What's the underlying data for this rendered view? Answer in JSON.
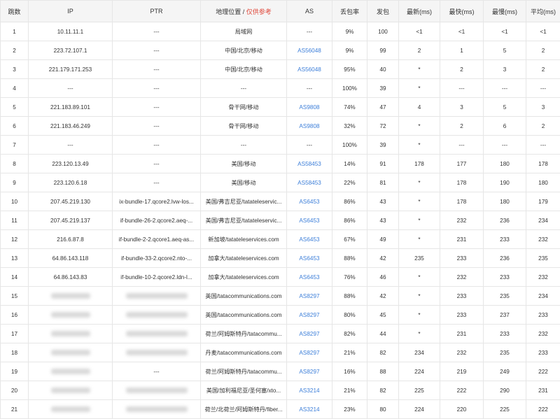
{
  "columns": {
    "hop": "跳数",
    "ip": "IP",
    "ptr": "PTR",
    "geo": "地理位置",
    "geo_sep": "/",
    "geo_note": "仅供参考",
    "as": "AS",
    "loss": "丢包率",
    "sent": "发包",
    "latest": "最新(ms)",
    "fastest": "最快(ms)",
    "slowest": "最慢(ms)",
    "avg": "平均(ms)"
  },
  "rows": [
    {
      "hop": "1",
      "ip": "10.11.11.1",
      "ptr": "---",
      "geo": "局域网",
      "as": "---",
      "loss": "9%",
      "sent": "100",
      "latest": "<1",
      "fastest": "<1",
      "slowest": "<1",
      "avg": "<1"
    },
    {
      "hop": "2",
      "ip": "223.72.107.1",
      "ptr": "---",
      "geo": "中国/北京/移动",
      "as": "AS56048",
      "loss": "9%",
      "sent": "99",
      "latest": "2",
      "fastest": "1",
      "slowest": "5",
      "avg": "2"
    },
    {
      "hop": "3",
      "ip": "221.179.171.253",
      "ptr": "---",
      "geo": "中国/北京/移动",
      "as": "AS56048",
      "loss": "95%",
      "sent": "40",
      "latest": "*",
      "fastest": "2",
      "slowest": "3",
      "avg": "2"
    },
    {
      "hop": "4",
      "ip": "---",
      "ptr": "---",
      "geo": "---",
      "as": "---",
      "loss": "100%",
      "sent": "39",
      "latest": "*",
      "fastest": "---",
      "slowest": "---",
      "avg": "---"
    },
    {
      "hop": "5",
      "ip": "221.183.89.101",
      "ptr": "---",
      "geo": "骨干网/移动",
      "as": "AS9808",
      "loss": "74%",
      "sent": "47",
      "latest": "4",
      "fastest": "3",
      "slowest": "5",
      "avg": "3"
    },
    {
      "hop": "6",
      "ip": "221.183.46.249",
      "ptr": "---",
      "geo": "骨干网/移动",
      "as": "AS9808",
      "loss": "32%",
      "sent": "72",
      "latest": "*",
      "fastest": "2",
      "slowest": "6",
      "avg": "2"
    },
    {
      "hop": "7",
      "ip": "---",
      "ptr": "---",
      "geo": "---",
      "as": "---",
      "loss": "100%",
      "sent": "39",
      "latest": "*",
      "fastest": "---",
      "slowest": "---",
      "avg": "---"
    },
    {
      "hop": "8",
      "ip": "223.120.13.49",
      "ptr": "---",
      "geo": "美国/移动",
      "as": "AS58453",
      "loss": "14%",
      "sent": "91",
      "latest": "178",
      "fastest": "177",
      "slowest": "180",
      "avg": "178"
    },
    {
      "hop": "9",
      "ip": "223.120.6.18",
      "ptr": "---",
      "geo": "美国/移动",
      "as": "AS58453",
      "loss": "22%",
      "sent": "81",
      "latest": "*",
      "fastest": "178",
      "slowest": "190",
      "avg": "180"
    },
    {
      "hop": "10",
      "ip": "207.45.219.130",
      "ptr": "ix-bundle-17.qcore2.lvw-los...",
      "geo": "美国/弗吉尼亚/tatateleservic...",
      "as": "AS6453",
      "loss": "86%",
      "sent": "43",
      "latest": "*",
      "fastest": "178",
      "slowest": "180",
      "avg": "179"
    },
    {
      "hop": "11",
      "ip": "207.45.219.137",
      "ptr": "if-bundle-26-2.qcore2.aeq-...",
      "geo": "美国/弗吉尼亚/tatateleservic...",
      "as": "AS6453",
      "loss": "86%",
      "sent": "43",
      "latest": "*",
      "fastest": "232",
      "slowest": "236",
      "avg": "234"
    },
    {
      "hop": "12",
      "ip": "216.6.87.8",
      "ptr": "if-bundle-2-2.qcore1.aeq-as...",
      "geo": "新加坡/tatateleservices.com",
      "as": "AS6453",
      "loss": "67%",
      "sent": "49",
      "latest": "*",
      "fastest": "231",
      "slowest": "233",
      "avg": "232"
    },
    {
      "hop": "13",
      "ip": "64.86.143.118",
      "ptr": "if-bundle-33-2.qcore2.nto-...",
      "geo": "加拿大/tatateleservices.com",
      "as": "AS6453",
      "loss": "88%",
      "sent": "42",
      "latest": "235",
      "fastest": "233",
      "slowest": "236",
      "avg": "235"
    },
    {
      "hop": "14",
      "ip": "64.86.143.83",
      "ptr": "if-bundle-10-2.qcore2.ldn-l...",
      "geo": "加拿大/tatateleservices.com",
      "as": "AS6453",
      "loss": "76%",
      "sent": "46",
      "latest": "*",
      "fastest": "232",
      "slowest": "233",
      "avg": "232"
    },
    {
      "hop": "15",
      "ip": "",
      "ptr": "",
      "geo": "英国/tatacommunications.com",
      "as": "AS8297",
      "loss": "88%",
      "sent": "42",
      "latest": "*",
      "fastest": "233",
      "slowest": "235",
      "avg": "234"
    },
    {
      "hop": "16",
      "ip": "",
      "ptr": "",
      "geo": "英国/tatacommunications.com",
      "as": "AS8297",
      "loss": "80%",
      "sent": "45",
      "latest": "*",
      "fastest": "233",
      "slowest": "237",
      "avg": "233"
    },
    {
      "hop": "17",
      "ip": "",
      "ptr": "",
      "geo": "荷兰/阿姆斯特丹/tatacommu...",
      "as": "AS8297",
      "loss": "82%",
      "sent": "44",
      "latest": "*",
      "fastest": "231",
      "slowest": "233",
      "avg": "232"
    },
    {
      "hop": "18",
      "ip": "",
      "ptr": "",
      "geo": "丹麦/tatacommunications.com",
      "as": "AS8297",
      "loss": "21%",
      "sent": "82",
      "latest": "234",
      "fastest": "232",
      "slowest": "235",
      "avg": "233"
    },
    {
      "hop": "19",
      "ip": "",
      "ptr": "---",
      "geo": "荷兰/阿姆斯特丹/tatacommu...",
      "as": "AS8297",
      "loss": "16%",
      "sent": "88",
      "latest": "224",
      "fastest": "219",
      "slowest": "249",
      "avg": "222"
    },
    {
      "hop": "20",
      "ip": "",
      "ptr": "",
      "geo": "美国/加利福尼亚/圣何塞/xto...",
      "as": "AS3214",
      "loss": "21%",
      "sent": "82",
      "latest": "225",
      "fastest": "222",
      "slowest": "290",
      "avg": "231"
    },
    {
      "hop": "21",
      "ip": "",
      "ptr": "",
      "geo": "荷兰/北荷兰/阿姆斯特丹/fiber...",
      "as": "AS3214",
      "loss": "23%",
      "sent": "80",
      "latest": "224",
      "fastest": "220",
      "slowest": "225",
      "avg": "222"
    }
  ]
}
